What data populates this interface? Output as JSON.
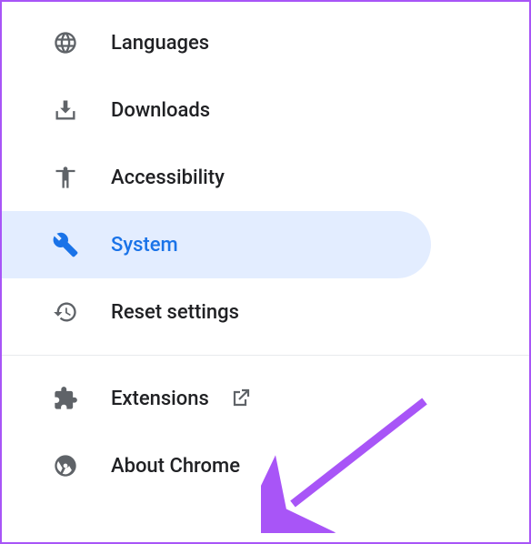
{
  "nav": {
    "items": [
      {
        "id": "languages",
        "label": "Languages",
        "icon": "globe-icon",
        "active": false
      },
      {
        "id": "downloads",
        "label": "Downloads",
        "icon": "download-icon",
        "active": false
      },
      {
        "id": "accessibility",
        "label": "Accessibility",
        "icon": "accessibility-icon",
        "active": false
      },
      {
        "id": "system",
        "label": "System",
        "icon": "wrench-icon",
        "active": true
      },
      {
        "id": "reset-settings",
        "label": "Reset settings",
        "icon": "history-icon",
        "active": false
      }
    ],
    "footer": [
      {
        "id": "extensions",
        "label": "Extensions",
        "icon": "puzzle-icon",
        "external": true
      },
      {
        "id": "about-chrome",
        "label": "About Chrome",
        "icon": "chrome-icon",
        "external": false
      }
    ]
  },
  "annotation": {
    "arrow_color": "#a855f7",
    "target": "about-chrome"
  }
}
